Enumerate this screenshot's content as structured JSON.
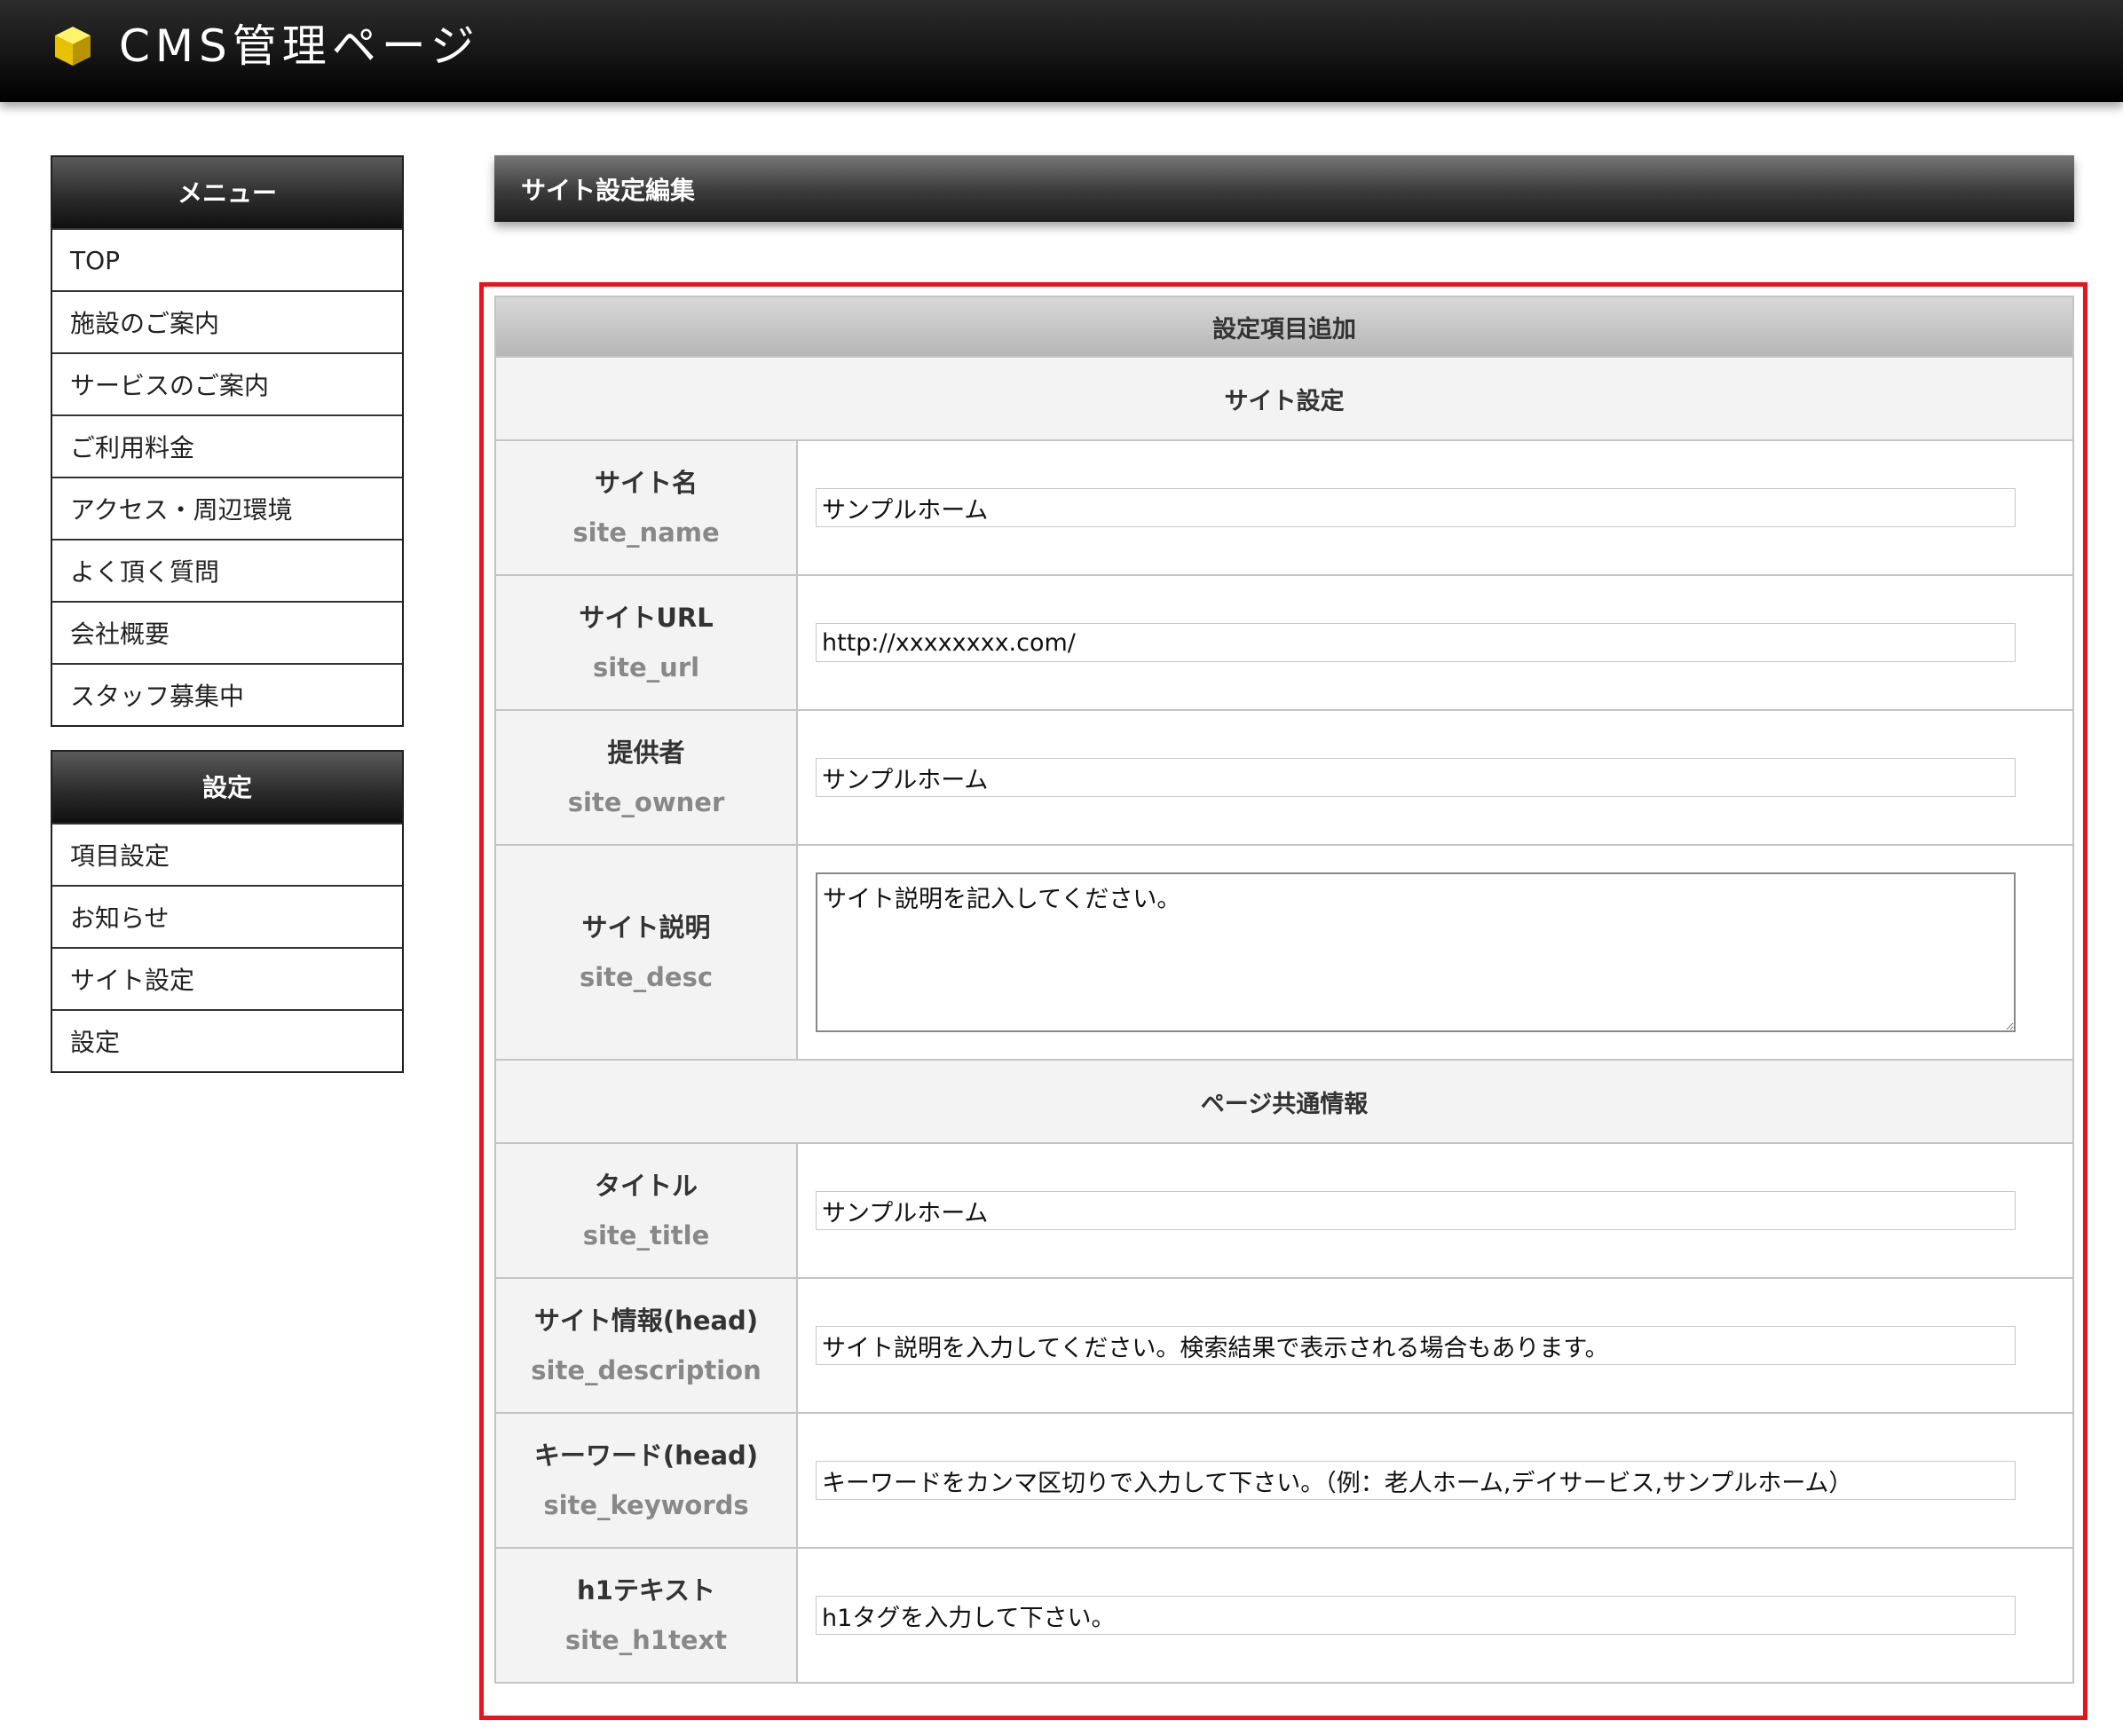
{
  "header": {
    "title": "CMS管理ページ",
    "logo_icon": "yellow-cube-icon"
  },
  "sidebar": {
    "menu": {
      "heading": "メニュー",
      "items": [
        {
          "label": "TOP"
        },
        {
          "label": "施設のご案内"
        },
        {
          "label": "サービスのご案内"
        },
        {
          "label": "ご利用料金"
        },
        {
          "label": "アクセス・周辺環境"
        },
        {
          "label": "よく頂く質問"
        },
        {
          "label": "会社概要"
        },
        {
          "label": "スタッフ募集中"
        }
      ]
    },
    "settings": {
      "heading": "設定",
      "items": [
        {
          "label": "項目設定"
        },
        {
          "label": "お知らせ"
        },
        {
          "label": "サイト設定"
        },
        {
          "label": "設定"
        }
      ]
    }
  },
  "main": {
    "page_title": "サイト設定編集",
    "form": {
      "caption": "設定項目追加",
      "section_site": "サイト設定",
      "section_common": "ページ共通情報",
      "fields": {
        "site_name": {
          "label": "サイト名",
          "key": "site_name",
          "value": "サンプルホーム"
        },
        "site_url": {
          "label": "サイトURL",
          "key": "site_url",
          "value": "http://xxxxxxxx.com/"
        },
        "site_owner": {
          "label": "提供者",
          "key": "site_owner",
          "value": "サンプルホーム"
        },
        "site_desc": {
          "label": "サイト説明",
          "key": "site_desc",
          "value": "サイト説明を記入してください。"
        },
        "site_title": {
          "label": "タイトル",
          "key": "site_title",
          "value": "サンプルホーム"
        },
        "site_description": {
          "label": "サイト情報(head)",
          "key": "site_description",
          "value": "サイト説明を入力してください。検索結果で表示される場合もあります。"
        },
        "site_keywords": {
          "label": "キーワード(head)",
          "key": "site_keywords",
          "value": "キーワードをカンマ区切りで入力して下さい。（例：老人ホーム,デイサービス,サンプルホーム）"
        },
        "site_h1text": {
          "label": "h1テキスト",
          "key": "site_h1text",
          "value": "h1タグを入力して下さい。"
        }
      }
    }
  },
  "colors": {
    "highlight_border": "#e8141b",
    "header_bg": "#111111",
    "label_sub": "#888888"
  }
}
